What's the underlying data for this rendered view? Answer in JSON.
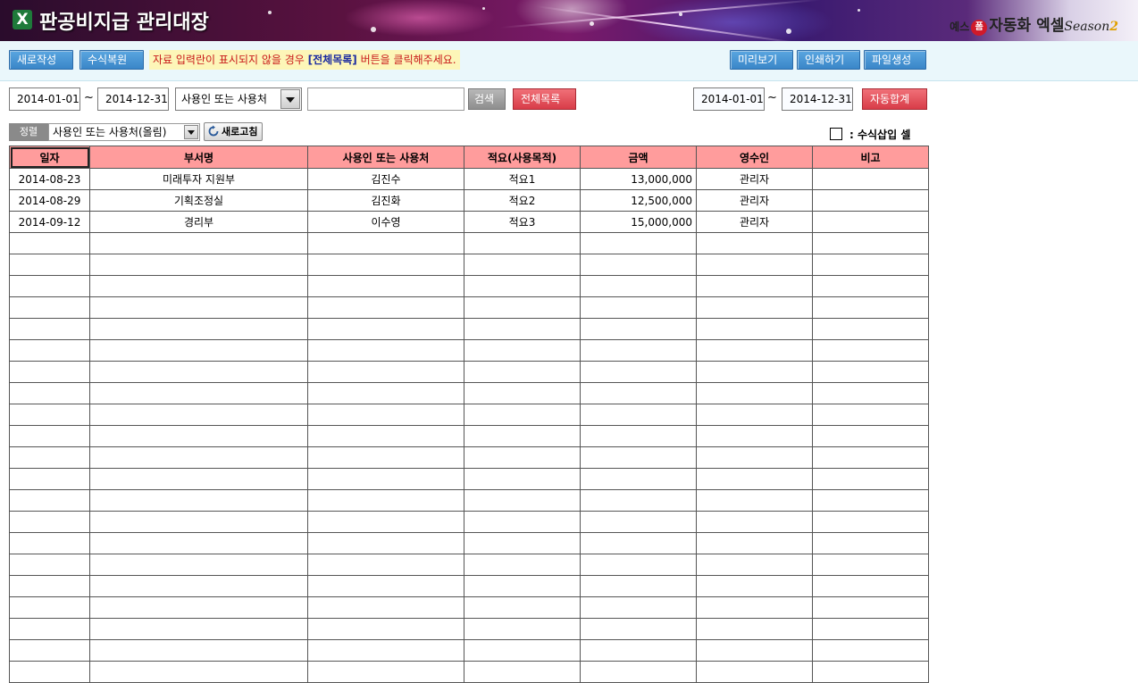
{
  "header": {
    "title": "판공비지급 관리대장",
    "logo_letter": "X",
    "brand": {
      "prefix": "예스",
      "badge": "폼",
      "name": "자동화 엑셀",
      "season": "Season",
      "season_num": "2"
    }
  },
  "toolbar": {
    "new_label": "새로작성",
    "restore_label": "수식복원",
    "notice_pre": "자료 입력란이 표시되지  않을 경우 ",
    "notice_kw": "[전체목록]",
    "notice_post": " 버튼을 클릭해주세요.",
    "preview_label": "미리보기",
    "print_label": "인쇄하기",
    "file_label": "파일생성"
  },
  "search": {
    "date_from": "2014-01-01",
    "tilde": "~",
    "date_to": "2014-12-31",
    "field_select": "사용인 또는 사용처",
    "query": "",
    "search_label": "검색",
    "all_list_label": "전체목록",
    "sum_date_from": "2014-01-01",
    "sum_date_to": "2014-12-31",
    "auto_sum_label": "자동합계"
  },
  "sort": {
    "label": "정렬",
    "value": "사용인 또는 사용처(올림)",
    "refresh_label": "새로고침",
    "legend_text": ": 수식삽입 셀"
  },
  "table": {
    "columns": [
      "일자",
      "부서명",
      "사용인 또는 사용처",
      "적요(사용목적)",
      "금액",
      "영수인",
      "비고"
    ],
    "rows": [
      [
        "2014-08-23",
        "미래투자 지원부",
        "김진수",
        "적요1",
        "13,000,000",
        "관리자",
        ""
      ],
      [
        "2014-08-29",
        "기획조정실",
        "김진화",
        "적요2",
        "12,500,000",
        "관리자",
        ""
      ],
      [
        "2014-09-12",
        "경리부",
        "이수영",
        "적요3",
        "15,000,000",
        "관리자",
        ""
      ],
      [
        "",
        "",
        "",
        "",
        "",
        "",
        ""
      ],
      [
        "",
        "",
        "",
        "",
        "",
        "",
        ""
      ],
      [
        "",
        "",
        "",
        "",
        "",
        "",
        ""
      ],
      [
        "",
        "",
        "",
        "",
        "",
        "",
        ""
      ],
      [
        "",
        "",
        "",
        "",
        "",
        "",
        ""
      ],
      [
        "",
        "",
        "",
        "",
        "",
        "",
        ""
      ],
      [
        "",
        "",
        "",
        "",
        "",
        "",
        ""
      ],
      [
        "",
        "",
        "",
        "",
        "",
        "",
        ""
      ],
      [
        "",
        "",
        "",
        "",
        "",
        "",
        ""
      ],
      [
        "",
        "",
        "",
        "",
        "",
        "",
        ""
      ],
      [
        "",
        "",
        "",
        "",
        "",
        "",
        ""
      ],
      [
        "",
        "",
        "",
        "",
        "",
        "",
        ""
      ],
      [
        "",
        "",
        "",
        "",
        "",
        "",
        ""
      ],
      [
        "",
        "",
        "",
        "",
        "",
        "",
        ""
      ],
      [
        "",
        "",
        "",
        "",
        "",
        "",
        ""
      ],
      [
        "",
        "",
        "",
        "",
        "",
        "",
        ""
      ],
      [
        "",
        "",
        "",
        "",
        "",
        "",
        ""
      ],
      [
        "",
        "",
        "",
        "",
        "",
        "",
        ""
      ],
      [
        "",
        "",
        "",
        "",
        "",
        "",
        ""
      ],
      [
        "",
        "",
        "",
        "",
        "",
        "",
        ""
      ],
      [
        "",
        "",
        "",
        "",
        "",
        "",
        ""
      ]
    ]
  },
  "colors": {
    "header_row": "#ff9c9c",
    "toolbar_bg": "#eaf7fb",
    "button_blue": "#3a86c8",
    "button_red": "#d83c48",
    "notice_bg": "#fdf6b8",
    "notice_text": "#c81818"
  }
}
